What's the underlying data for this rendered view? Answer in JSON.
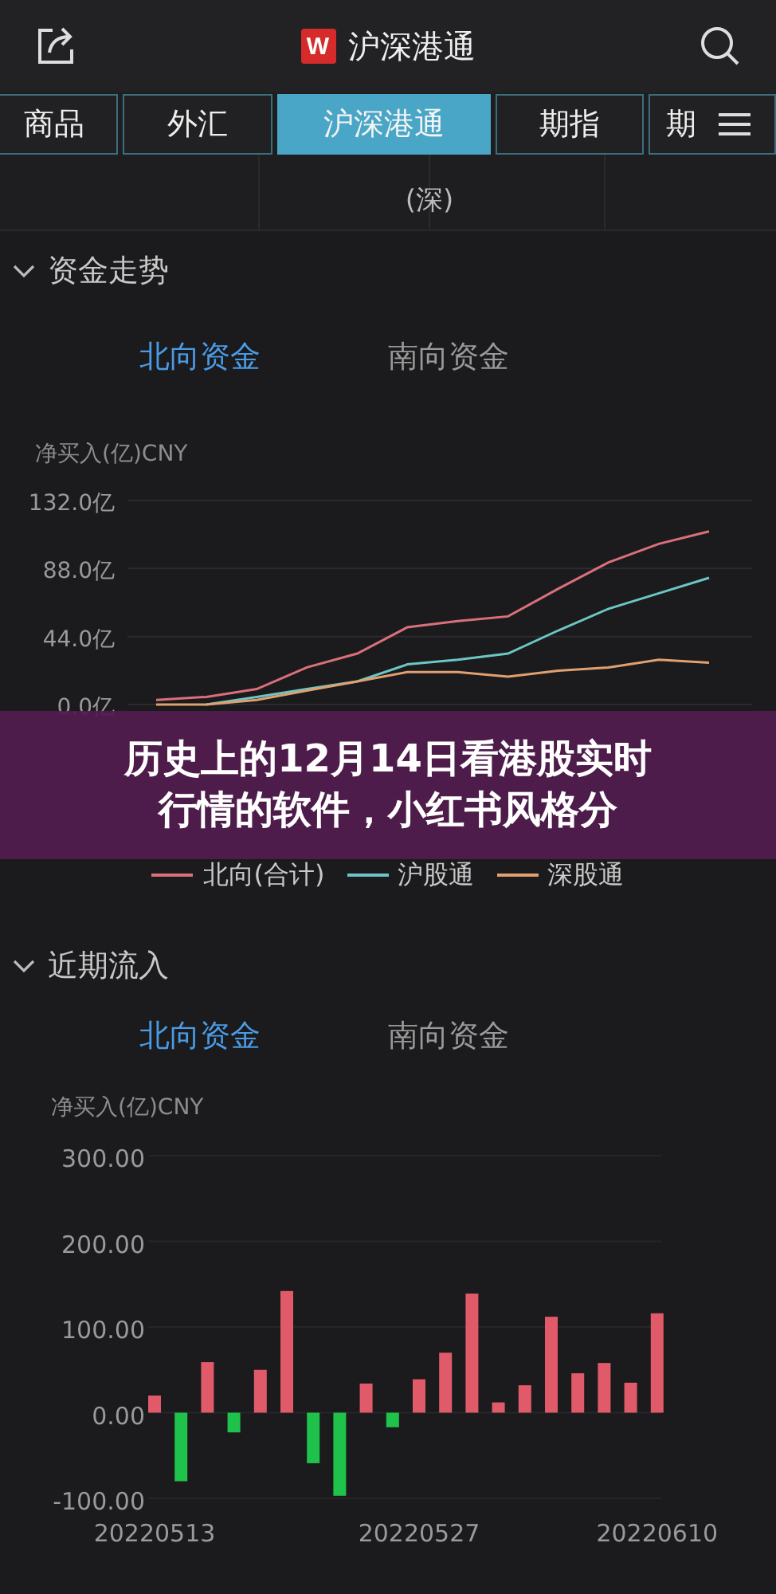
{
  "header": {
    "logo": "W",
    "title": "沪深港通"
  },
  "tabs": [
    {
      "label": "商品",
      "selected": false
    },
    {
      "label": "外汇",
      "selected": false
    },
    {
      "label": "沪深港通",
      "selected": true
    },
    {
      "label": "期指",
      "selected": false
    },
    {
      "label": "期",
      "selected": false
    }
  ],
  "table_row": {
    "cells": [
      "(深)"
    ]
  },
  "sections": [
    {
      "title": "资金走势",
      "expanded": true,
      "subtabs": [
        {
          "label": "北向资金",
          "selected": true
        },
        {
          "label": "南向资金",
          "selected": false
        }
      ],
      "chart_data": {
        "type": "line",
        "ylabel": "净买入(亿)CNY",
        "grid": true,
        "ylim": [
          0,
          132
        ],
        "yticks": [
          {
            "value": 0,
            "label": "0.0亿"
          },
          {
            "value": 44,
            "label": "44.0亿"
          },
          {
            "value": 88,
            "label": "88.0亿"
          },
          {
            "value": 132,
            "label": "132.0亿"
          }
        ],
        "categories": [
          null,
          null,
          null,
          null,
          null,
          null,
          null,
          null,
          null,
          null,
          null,
          null
        ],
        "series": [
          {
            "name": "北向(合计)",
            "color": "#d9707a",
            "values": [
              3,
              5,
              10,
              24,
              33,
              50,
              54,
              57,
              75,
              92,
              104,
              112
            ]
          },
          {
            "name": "沪股通",
            "color": "#6cc6c4",
            "values": [
              null,
              0,
              5,
              10,
              15,
              26,
              29,
              33,
              48,
              62,
              72,
              82
            ]
          },
          {
            "name": "深股通",
            "color": "#e0a070",
            "values": [
              0,
              0,
              3,
              9,
              15,
              21,
              21,
              18,
              22,
              24,
              29,
              27
            ]
          }
        ]
      }
    },
    {
      "title": "近期流入",
      "expanded": true,
      "subtabs": [
        {
          "label": "北向资金",
          "selected": true
        },
        {
          "label": "南向资金",
          "selected": false
        }
      ],
      "chart_data": {
        "type": "bar",
        "ylabel": "净买入(亿)CNY",
        "ylim": [
          -100,
          300
        ],
        "grid": true,
        "yticks": [
          {
            "value": -100,
            "label": "-100.00"
          },
          {
            "value": 0,
            "label": "0.00"
          },
          {
            "value": 100,
            "label": "100.00"
          },
          {
            "value": 200,
            "label": "200.00"
          },
          {
            "value": 300,
            "label": "300.00"
          }
        ],
        "categories": [
          "20220513",
          null,
          null,
          null,
          null,
          null,
          null,
          null,
          null,
          null,
          "20220527",
          null,
          null,
          null,
          null,
          null,
          null,
          null,
          null,
          "20220610"
        ],
        "series": [
          {
            "color": "#e05a6a",
            "values": [
              20,
              null,
              59,
              null,
              50,
              142,
              null,
              null,
              34,
              null,
              39,
              70,
              139,
              12,
              32,
              112,
              46,
              58,
              35,
              116
            ]
          },
          {
            "color": "#1fc24a",
            "values": [
              null,
              -80,
              null,
              -23,
              null,
              null,
              -59,
              -97,
              null,
              -17,
              null,
              null,
              null,
              null,
              null,
              null,
              null,
              null,
              null,
              null
            ]
          }
        ]
      }
    }
  ],
  "banner": {
    "text": "历史上的12月14日看港股实时行情的软件，小红书风格分"
  }
}
